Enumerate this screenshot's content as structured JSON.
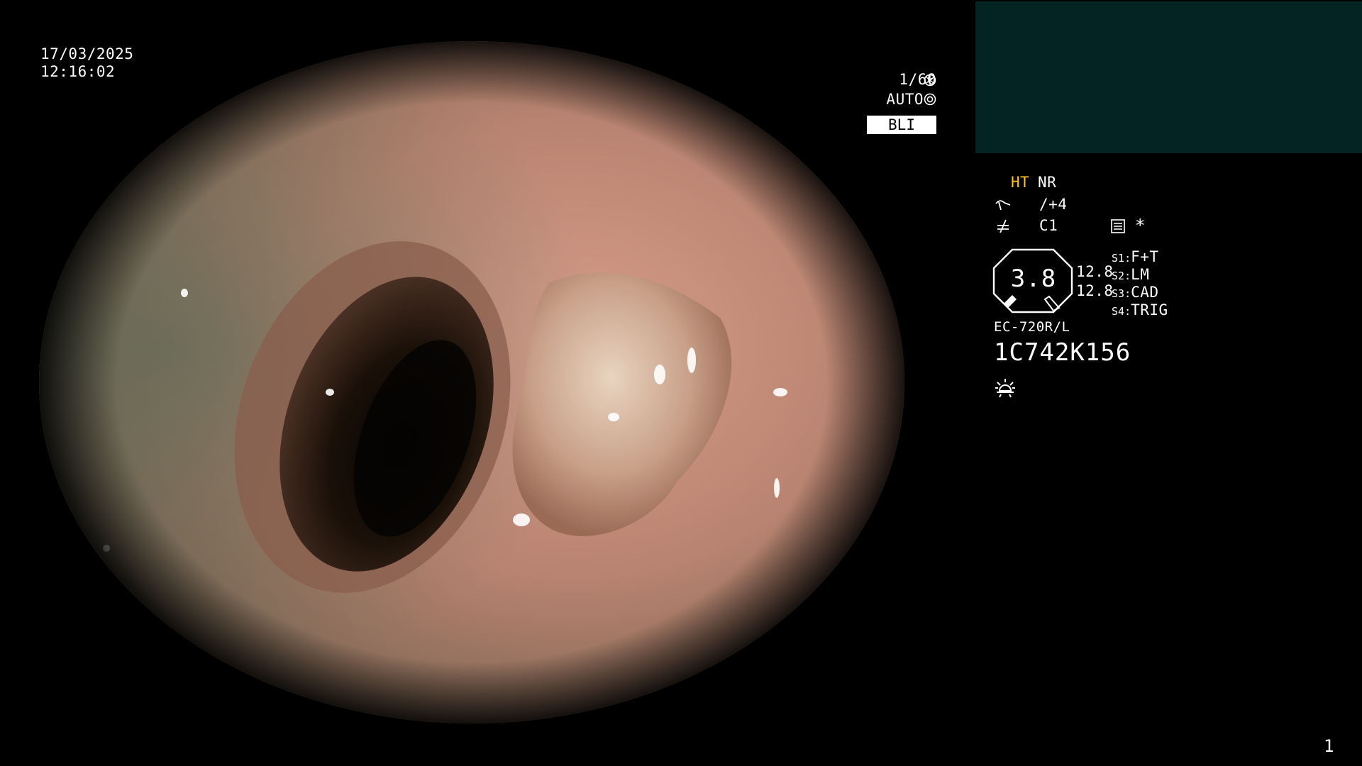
{
  "overlay": {
    "date": "17/03/2025",
    "time": "12:16:02",
    "shutter": "1/60",
    "exposure": "AUTO",
    "mode_badge": "BLI"
  },
  "panel": {
    "ht": "HT",
    "nr": "NR",
    "enhance_value": "/+4",
    "color_value": "C1",
    "asterisk": "*",
    "zoom_value": "3.8",
    "value_a": "12.8",
    "value_b": "12.8",
    "switches": [
      {
        "key": "S1",
        "label": "F+T"
      },
      {
        "key": "S2",
        "label": "LM"
      },
      {
        "key": "S3",
        "label": "CAD"
      },
      {
        "key": "S4",
        "label": "TRIG"
      }
    ],
    "scope_model": "EC-720R/L",
    "serial": "1C742K156",
    "page_number": "1"
  },
  "colors": {
    "mode_panel": "#042424",
    "accent_yellow": "#ffc21a"
  },
  "icons": {
    "shutter": "aperture-icon",
    "exposure": "iris-icon",
    "enhance": "enhance-icon",
    "color": "color-icon",
    "menu": "menu-icon",
    "light": "sun-icon"
  }
}
